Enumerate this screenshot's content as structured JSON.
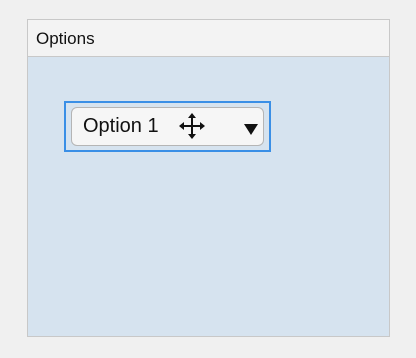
{
  "panel": {
    "title": "Options"
  },
  "dropdown": {
    "selected_value": "Option 1"
  },
  "icons": {
    "cursor": "move-cursor-icon",
    "chevron": "chevron-down-icon"
  },
  "colors": {
    "focus_border": "#3a8fe6",
    "panel_background": "#d6e3ef"
  }
}
